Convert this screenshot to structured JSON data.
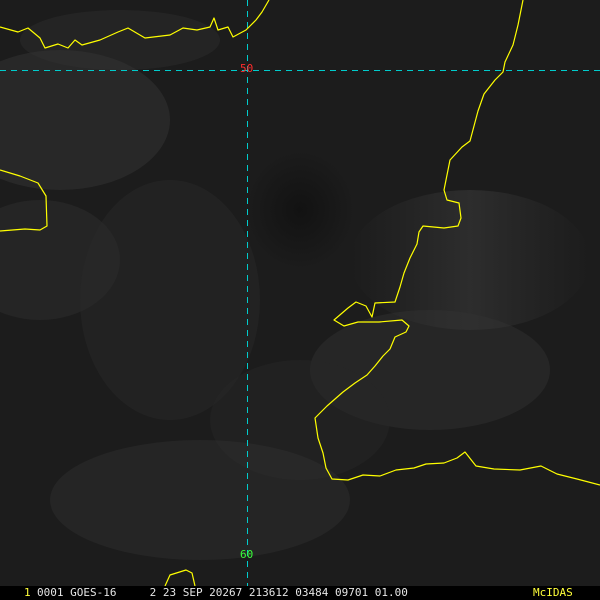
{
  "colors": {
    "coastline": "#ffff00",
    "graticule": "#00cccc",
    "lat50_label": "#ff2b2b",
    "lat60_label": "#39ff39",
    "frame_number": "#ffff3a",
    "status_text": "#e6e6e6",
    "brand": "#ffff3a"
  },
  "graticule": {
    "lat_label_50": "50",
    "lat_label_60": "60"
  },
  "statusbar": {
    "frame_number": "1",
    "text": "0001 GOES-16     2 23 SEP 20267 213612 03484 09701 01.00",
    "brand": "McIDAS"
  }
}
